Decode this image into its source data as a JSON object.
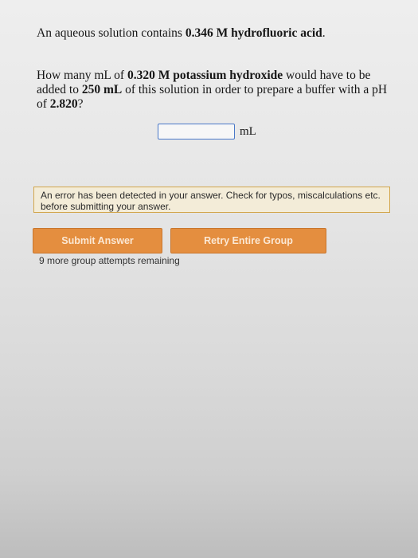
{
  "question": {
    "intro_pre": "An aqueous solution contains ",
    "intro_bold": "0.346 M hydrofluoric acid",
    "intro_post": ".",
    "line_a": "How many mL of ",
    "line_b_bold": "0.320 M potassium hydroxide",
    "line_c": " would have to be added to ",
    "line_d_bold": "250 mL",
    "line_e": " of this solution in order to prepare a buffer with a pH of ",
    "line_f_bold": "2.820",
    "line_g": "?"
  },
  "answer": {
    "value": "",
    "unit": "mL"
  },
  "error_message": "An error has been detected in your answer. Check for typos, miscalculations etc. before submitting your answer.",
  "buttons": {
    "submit_label": "Submit Answer",
    "retry_label": "Retry Entire Group"
  },
  "attempts_text": "9 more group attempts remaining",
  "colors": {
    "button_orange": "#e48e3f",
    "error_border": "#d2a64d",
    "input_border": "#4a78c8"
  }
}
